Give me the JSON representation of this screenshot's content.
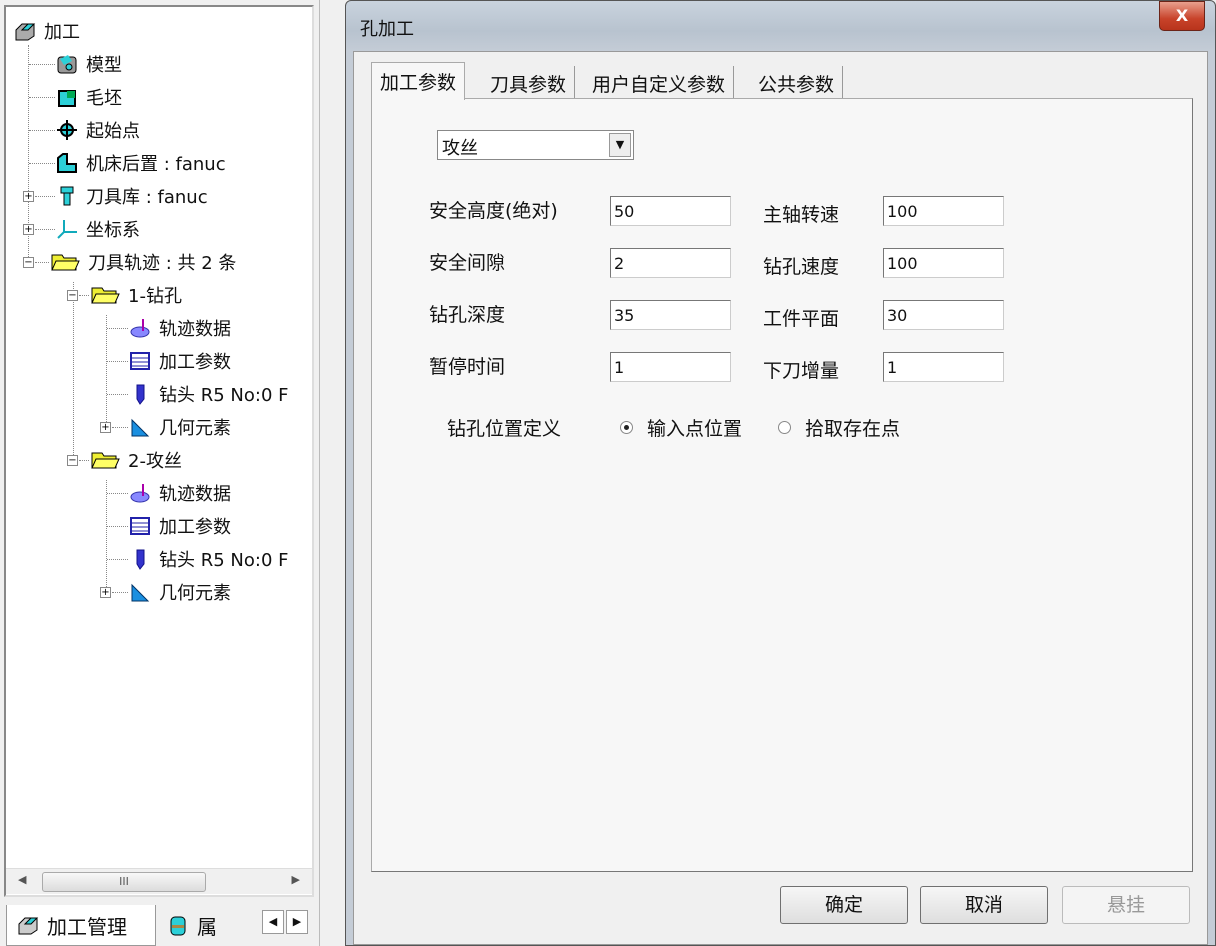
{
  "tree": {
    "root": "加工",
    "items": [
      {
        "label": "模型",
        "icon": "model-icon"
      },
      {
        "label": "毛坯",
        "icon": "stock-icon"
      },
      {
        "label": "起始点",
        "icon": "start-point-icon"
      },
      {
        "label": "机床后置 : fanuc",
        "icon": "machine-post-icon"
      },
      {
        "label": "刀具库 : fanuc",
        "icon": "tool-library-icon"
      },
      {
        "label": "坐标系",
        "icon": "coordinate-system-icon"
      },
      {
        "label": "刀具轨迹 : 共 2 条",
        "icon": "folder-open-icon"
      }
    ],
    "paths": [
      {
        "label": "1-钻孔",
        "children": [
          "轨迹数据",
          "加工参数",
          "钻头 R5 No:0 F",
          "几何元素"
        ]
      },
      {
        "label": "2-攻丝",
        "children": [
          "轨迹数据",
          "加工参数",
          "钻头 R5 No:0 F",
          "几何元素"
        ]
      }
    ],
    "scroll_thumb": "III"
  },
  "bottom_tabs": [
    "加工管理",
    "属"
  ],
  "dialog": {
    "title": "孔加工",
    "close": "X",
    "tabs": [
      "加工参数",
      "刀具参数",
      "用户自定义参数",
      "公共参数"
    ],
    "mode": "攻丝",
    "fields_left": [
      {
        "label": "安全高度(绝对)",
        "value": "50"
      },
      {
        "label": "安全间隙",
        "value": "2"
      },
      {
        "label": "钻孔深度",
        "value": "35"
      },
      {
        "label": "暂停时间",
        "value": "1"
      }
    ],
    "fields_right": [
      {
        "label": "主轴转速",
        "value": "100"
      },
      {
        "label": "钻孔速度",
        "value": "100"
      },
      {
        "label": "工件平面",
        "value": "30"
      },
      {
        "label": "下刀增量",
        "value": "1"
      }
    ],
    "position_label": "钻孔位置定义",
    "radio_input": "输入点位置",
    "radio_pick": "拾取存在点",
    "radio_selected": "输入点位置",
    "ok": "确定",
    "cancel": "取消",
    "suspend": "悬挂"
  }
}
